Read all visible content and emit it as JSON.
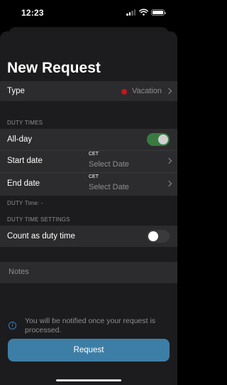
{
  "status_bar": {
    "time": "12:23",
    "icons": [
      "cellular-signal-icon",
      "wifi-icon",
      "battery-icon"
    ]
  },
  "page": {
    "title": "New Request"
  },
  "type_row": {
    "label": "Type",
    "value": "Vacation",
    "dot_color": "#c0191d"
  },
  "duty_times": {
    "header": "DUTY TIMES",
    "all_day": {
      "label": "All-day",
      "on": true
    },
    "start_date": {
      "label": "Start date",
      "timezone": "CET",
      "placeholder": "Select Date"
    },
    "end_date": {
      "label": "End date",
      "timezone": "CET",
      "placeholder": "Select Date"
    },
    "duty_time_summary": "DUTY Time: -"
  },
  "duty_time_settings": {
    "header": "DUTY TIME SETTINGS",
    "count_as_duty": {
      "label": "Count as duty time",
      "on": false
    }
  },
  "notes": {
    "placeholder": "Notes"
  },
  "info": {
    "icon": "info-icon",
    "text": "You will be notified once your request is processed."
  },
  "actions": {
    "request_label": "Request",
    "accent": "#3d7ea6"
  },
  "colors": {
    "background": "#1c1c1e",
    "row": "#2c2c2e",
    "secondary_text": "#8e8e93",
    "toggle_on": "#3a7a40"
  }
}
